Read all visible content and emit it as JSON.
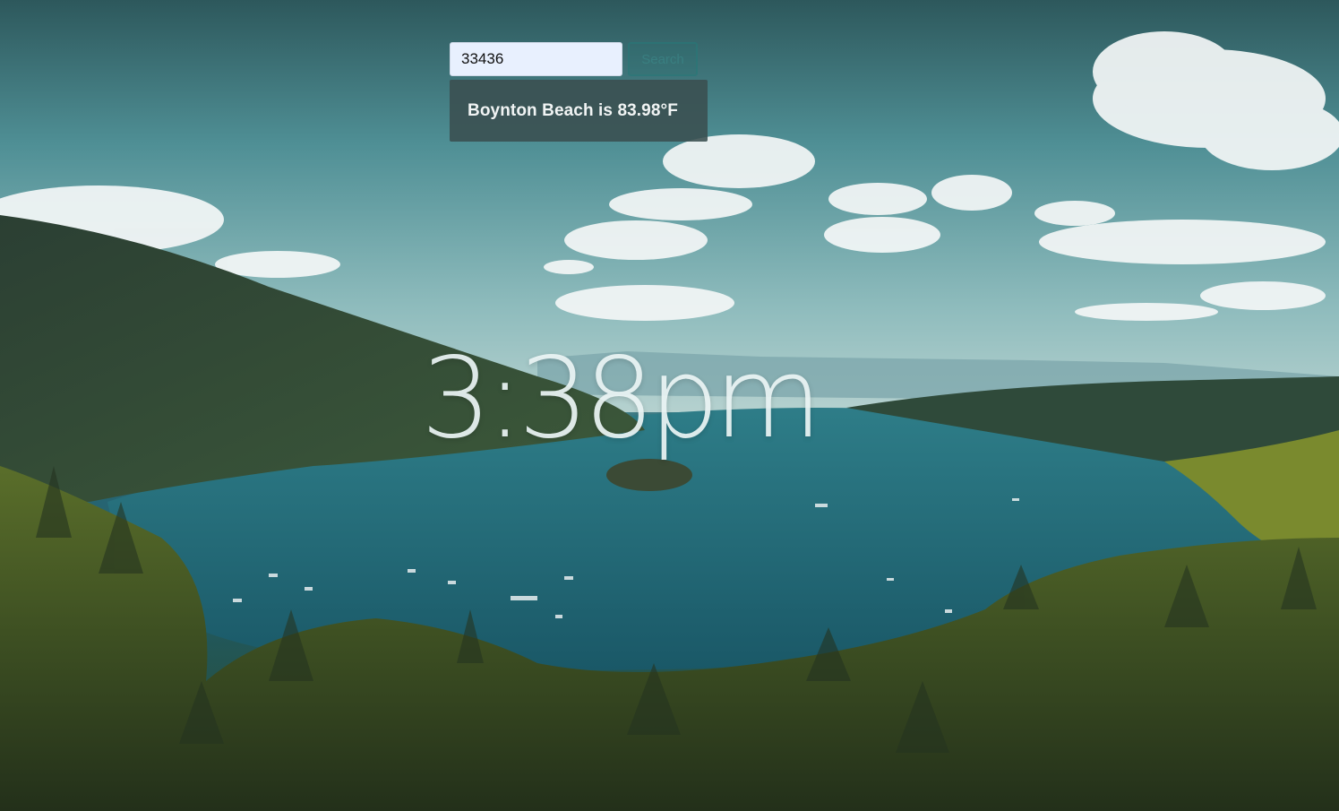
{
  "search": {
    "zip_value": "33436",
    "button_label": "Search"
  },
  "weather": {
    "summary": "Boynton Beach is 83.98°F"
  },
  "clock": {
    "time": "3:38pm"
  },
  "background": {
    "scene": "lake-landscape",
    "sky_color": "#4f8f95",
    "water_color": "#1f6675",
    "forest_color": "#2f4a2c"
  }
}
